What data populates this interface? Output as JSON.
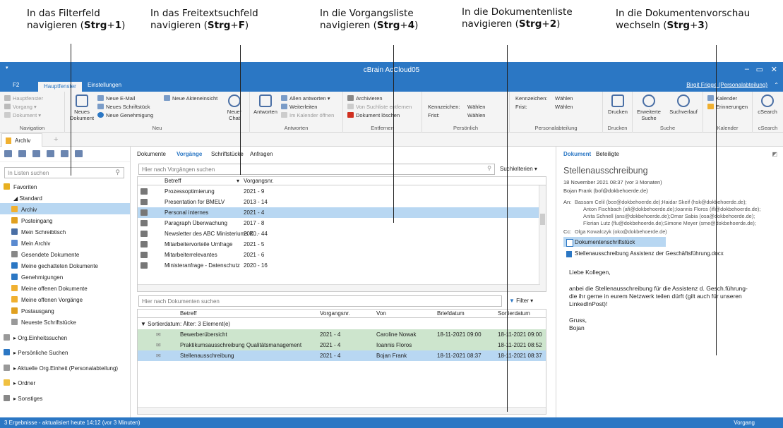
{
  "annotations": [
    {
      "line1": "In das Filterfeld",
      "line2_pre": "navigieren (",
      "key": "Strg",
      "plus": "+",
      "num": "1",
      "close": ")"
    },
    {
      "line1": "In das Freitextsuchfeld",
      "line2_pre": "navigieren (",
      "key": "Strg",
      "plus": "+",
      "num": "F",
      "close": ")"
    },
    {
      "line1": "In die Vorgangsliste",
      "line2_pre": "navigieren (",
      "key": "Strg",
      "plus": "+",
      "num": "4",
      "close": ")"
    },
    {
      "line1": "In die Dokumentenliste",
      "line2_pre": "navigieren (",
      "key": "Strg",
      "plus": "+",
      "num": "2",
      "close": ")"
    },
    {
      "line1": "In die Dokumentenvorschau",
      "line2_pre": "wechseln (",
      "key": "Strg",
      "plus": "+",
      "num": "3",
      "close": ")"
    }
  ],
  "window": {
    "title": "cBrain AcCloud05",
    "min": "‒",
    "max": "▭",
    "close": "✕"
  },
  "ribbon_tabs": {
    "f2": "F2",
    "main": "Hauptfenster",
    "settings": "Einstellungen",
    "user": "Birgit Frigge (Personalabteilung)",
    "collapse": "⌃"
  },
  "ribbon": {
    "nav": {
      "items": [
        "Hauptfenster",
        "Vorgang ▾",
        "Dokument ▾"
      ],
      "label": "Navigation"
    },
    "new": {
      "big": "Neues Dokument",
      "items": [
        "Neue E-Mail",
        "Neues Schriftstück",
        "Neue Genehmigung"
      ],
      "item2": "Neue Akteneinsicht",
      "chat": "Neuer Chat",
      "label": "Neu"
    },
    "reply": {
      "big": "Antworten",
      "items": [
        "Allen antworten ▾",
        "Weiterleiten",
        "Im Kalender öffnen"
      ],
      "label": "Antworten"
    },
    "remove": {
      "items": [
        "Archivieren",
        "Von Suchliste entfernen",
        "Dokument löschen"
      ],
      "label": "Entfernen"
    },
    "personal": {
      "kz": "Kennzeichen:",
      "kz_val": "Wählen",
      "frist": "Frist:",
      "frist_val": "Wählen",
      "label": "Persönlich"
    },
    "dept": {
      "kz": "Kennzeichen:",
      "kz_val": "Wählen",
      "frist": "Frist:",
      "frist_val": "Wählen",
      "label": "Personalabteilung"
    },
    "print": {
      "big": "Drucken",
      "label": "Drucken"
    },
    "search": {
      "b1": "Erweiterte Suche",
      "b2": "Suchverlauf",
      "label": "Suche"
    },
    "cal": {
      "items": [
        "Kalender",
        "Erinnerungen"
      ],
      "label": "Kalender"
    },
    "csearch": {
      "big": "cSearch",
      "label": "cSearch"
    }
  },
  "doc_tab": "Archiv",
  "left": {
    "search_placeholder": "In Listen suchen",
    "items": [
      {
        "label": "Favoriten",
        "color": "#e8b020",
        "lvl": 0
      },
      {
        "label": "◢ Standard",
        "color": "#ffffff",
        "lvl": 0
      },
      {
        "label": "Archiv",
        "color": "#f0b030",
        "lvl": 1,
        "sel": true
      },
      {
        "label": "Posteingang",
        "color": "#e0a020",
        "lvl": 1
      },
      {
        "label": "Mein Schreibtisch",
        "color": "#4a6fa5",
        "lvl": 1
      },
      {
        "label": "Mein Archiv",
        "color": "#5a8ad0",
        "lvl": 1
      },
      {
        "label": "Gesendete Dokumente",
        "color": "#888888",
        "lvl": 1
      },
      {
        "label": "Meine gechatteten Dokumente",
        "color": "#2b77c4",
        "lvl": 1
      },
      {
        "label": "Genehmigungen",
        "color": "#2b77c4",
        "lvl": 1
      },
      {
        "label": "Meine offenen Dokumente",
        "color": "#f0b030",
        "lvl": 1
      },
      {
        "label": "Meine offenen Vorgänge",
        "color": "#f0b030",
        "lvl": 1
      },
      {
        "label": "Postausgang",
        "color": "#e0a020",
        "lvl": 1
      },
      {
        "label": "Neueste Schriftstücke",
        "color": "#999999",
        "lvl": 1
      },
      {
        "label": "▸ Org.Einheitssuchen",
        "color": "#999999",
        "lvl": 0
      },
      {
        "label": "▸ Persönliche Suchen",
        "color": "#2b77c4",
        "lvl": 0
      },
      {
        "label": "▸ Aktuelle Org.Einheit (Personalabteilung)",
        "color": "#999999",
        "lvl": 0
      },
      {
        "label": "▸ Ordner",
        "color": "#f0c040",
        "lvl": 0
      },
      {
        "label": "▸ Sonstiges",
        "color": "#888888",
        "lvl": 0
      }
    ]
  },
  "center": {
    "tabs": [
      "Dokumente",
      "Vorgänge",
      "Schriftstücke",
      "Anfragen"
    ],
    "search1": "Hier nach Vorgängen suchen",
    "crit": "Suchkriterien ▾",
    "cols1": [
      "Betreff",
      "Vorgangsnr."
    ],
    "rows1": [
      [
        "Prozessoptimierung",
        "2021 - 9"
      ],
      [
        "Presentation for BMELV",
        "2013 - 14"
      ],
      [
        "Personal internes",
        "2021 - 4"
      ],
      [
        "Paragraph Überwachung",
        "2017 - 8"
      ],
      [
        "Newsletter des ABC Ministeriums K...",
        "2020 - 44"
      ],
      [
        "Mitarbeitervorteile Umfrage",
        "2021 - 5"
      ],
      [
        "Mitarbeiterrelevantes",
        "2021 - 6"
      ],
      [
        "Ministeranfrage - Datenschutz",
        "2020 - 16"
      ]
    ],
    "search2": "Hier nach Dokumenten suchen",
    "filter": "Filter ▾",
    "cols2": [
      "Betreff",
      "Vorgangsnr.",
      "Von",
      "Briefdatum",
      "Sortierdatum"
    ],
    "group": "▼ Sortierdatum: Älter: 3 Element(e)",
    "rows2": [
      [
        "Bewerberübersicht",
        "2021 - 4",
        "Caroline Nowak",
        "18-11-2021 09:00",
        "18-11-2021 09:00"
      ],
      [
        "Praktikumsausschreibung Qualitätsmanagement",
        "2021 - 4",
        "Ioannis Floros",
        "",
        "18-11-2021 08:52"
      ],
      [
        "Stellenausschreibung",
        "2021 - 4",
        "Bojan Frank",
        "18-11-2021 08:37",
        "18-11-2021 08:37"
      ]
    ]
  },
  "preview": {
    "tabs": [
      "Dokument",
      "Beteiligte"
    ],
    "title": "Stellenausschreibung",
    "date": "18 November 2021 08:37 (vor 3 Monaten)",
    "from": "Bojan Frank (bof@dokbehoerde.de)",
    "an_label": "An:",
    "to": [
      "Bassam Celil (bce@dokbehoerde.de);Haidar Skeif (hsk@dokbehoerde.de);",
      "Anton Fischbach (afi@dokbehoerde.de);Ioannis Floros (ifl@dokbehoerde.de);",
      "Anita Schnell (ans@dokbehoerde.de);Omar Sabia (osa@dokbehoerde.de);",
      "Florian Lutz (flu@dokbehoerde.de);Simone Meyer (sme@dokbehoerde.de);"
    ],
    "cc_label": "Cc:",
    "cc": "Olga Kowalczyk (oko@dokbehoerde.de)",
    "att1": "Dokumentenschriftstück",
    "att2": "Stellenausschreibung Assistenz der Geschäftsführung.docx",
    "body": [
      "Liebe Kollegen,",
      "anbei die Stellenausschreibung für die Assistenz d. Gesch.führung-",
      "die ihr gerne in eurem Netzwerk teilen dürft (gilt auch für unseren",
      "LinkedInPost)!",
      "Gruss,",
      "Bojan"
    ]
  },
  "status": {
    "left": "3 Ergebnisse - aktualisiert heute 14:12 (vor 3 Minuten)",
    "right": "Vorgang"
  }
}
